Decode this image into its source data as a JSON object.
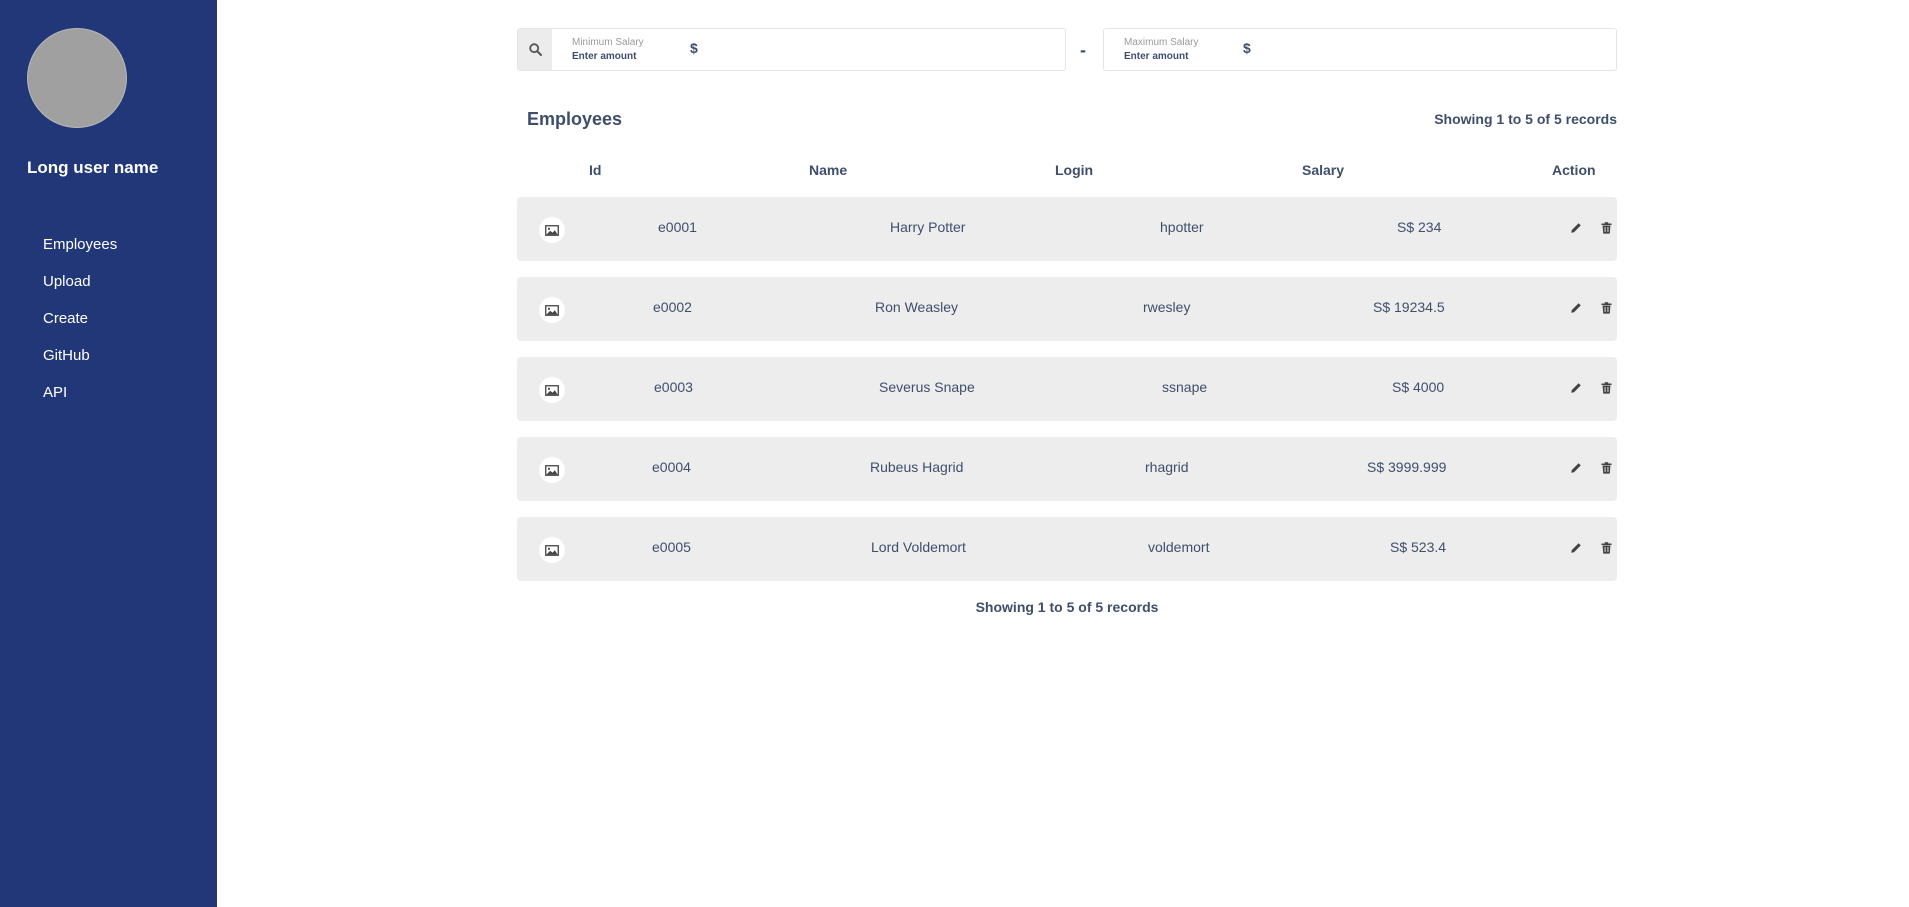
{
  "user": {
    "name": "Long user name"
  },
  "nav": {
    "items": [
      "Employees",
      "Upload",
      "Create",
      "GitHub",
      "API"
    ]
  },
  "filters": {
    "min": {
      "label": "Minimum Salary",
      "placeholder": "Enter amount",
      "currency": "$",
      "value": ""
    },
    "separator": "-",
    "max": {
      "label": "Maximum Salary",
      "placeholder": "Enter amount",
      "currency": "$",
      "value": ""
    }
  },
  "table": {
    "title": "Employees",
    "summary": "Showing 1 to 5 of 5 records",
    "columns": [
      "Id",
      "Name",
      "Login",
      "Salary",
      "Action"
    ],
    "rows": [
      {
        "id": "e0001",
        "name": "Harry Potter",
        "login": "hpotter",
        "salary": "S$ 234"
      },
      {
        "id": "e0002",
        "name": "Ron Weasley",
        "login": "rwesley",
        "salary": "S$ 19234.5"
      },
      {
        "id": "e0003",
        "name": "Severus Snape",
        "login": "ssnape",
        "salary": "S$ 4000"
      },
      {
        "id": "e0004",
        "name": "Rubeus Hagrid",
        "login": "rhagrid",
        "salary": "S$ 3999.999"
      },
      {
        "id": "e0005",
        "name": "Lord Voldemort",
        "login": "voldemort",
        "salary": "S$ 523.4"
      }
    ],
    "footer": "Showing 1 to 5 of 5 records"
  },
  "icons": {
    "search": "search-icon",
    "thumbnail": "image-icon",
    "edit": "pencil-icon",
    "delete": "trash-icon"
  },
  "colors": {
    "sidebar": "#213778",
    "text": "#3f4e6b",
    "row_bg": "#ededed"
  }
}
